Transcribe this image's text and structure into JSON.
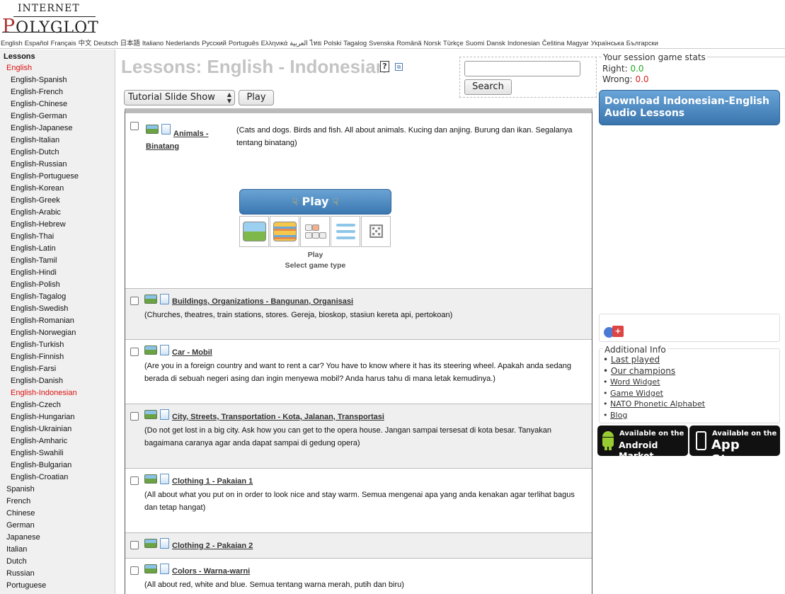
{
  "logo": {
    "top": "INTERNET",
    "first_letter": "P",
    "rest": "OLYGLOT"
  },
  "languages": [
    "English",
    "Español",
    "Français",
    "中文",
    "Deutsch",
    "日本語",
    "Italiano",
    "Nederlands",
    "Русский",
    "Português",
    "Ελληνικά",
    "العربية",
    "ไทย",
    "Polski",
    "Tagalog",
    "Svenska",
    "Română",
    "Norsk",
    "Türkçe",
    "Suomi",
    "Dansk",
    "Indonesian",
    "Čeština",
    "Magyar",
    "Українська",
    "Български"
  ],
  "sidebar": {
    "heading": "Lessons",
    "items": [
      {
        "label": "English",
        "level": 0,
        "active": true
      },
      {
        "label": "English-Spanish",
        "level": 1
      },
      {
        "label": "English-French",
        "level": 1
      },
      {
        "label": "English-Chinese",
        "level": 1
      },
      {
        "label": "English-German",
        "level": 1
      },
      {
        "label": "English-Japanese",
        "level": 1
      },
      {
        "label": "English-Italian",
        "level": 1
      },
      {
        "label": "English-Dutch",
        "level": 1
      },
      {
        "label": "English-Russian",
        "level": 1
      },
      {
        "label": "English-Portuguese",
        "level": 1
      },
      {
        "label": "English-Korean",
        "level": 1
      },
      {
        "label": "English-Greek",
        "level": 1
      },
      {
        "label": "English-Arabic",
        "level": 1
      },
      {
        "label": "English-Hebrew",
        "level": 1
      },
      {
        "label": "English-Thai",
        "level": 1
      },
      {
        "label": "English-Latin",
        "level": 1
      },
      {
        "label": "English-Tamil",
        "level": 1
      },
      {
        "label": "English-Hindi",
        "level": 1
      },
      {
        "label": "English-Polish",
        "level": 1
      },
      {
        "label": "English-Tagalog",
        "level": 1
      },
      {
        "label": "English-Swedish",
        "level": 1
      },
      {
        "label": "English-Romanian",
        "level": 1
      },
      {
        "label": "English-Norwegian",
        "level": 1
      },
      {
        "label": "English-Turkish",
        "level": 1
      },
      {
        "label": "English-Finnish",
        "level": 1
      },
      {
        "label": "English-Farsi",
        "level": 1
      },
      {
        "label": "English-Danish",
        "level": 1
      },
      {
        "label": "English-Indonesian",
        "level": 1,
        "active": true
      },
      {
        "label": "English-Czech",
        "level": 1
      },
      {
        "label": "English-Hungarian",
        "level": 1
      },
      {
        "label": "English-Ukrainian",
        "level": 1
      },
      {
        "label": "English-Amharic",
        "level": 1
      },
      {
        "label": "English-Swahili",
        "level": 1
      },
      {
        "label": "English-Bulgarian",
        "level": 1
      },
      {
        "label": "English-Croatian",
        "level": 1
      },
      {
        "label": "Spanish",
        "level": 0
      },
      {
        "label": "French",
        "level": 0
      },
      {
        "label": "Chinese",
        "level": 0
      },
      {
        "label": "German",
        "level": 0
      },
      {
        "label": "Japanese",
        "level": 0
      },
      {
        "label": "Italian",
        "level": 0
      },
      {
        "label": "Dutch",
        "level": 0
      },
      {
        "label": "Russian",
        "level": 0
      },
      {
        "label": "Portuguese",
        "level": 0
      }
    ]
  },
  "main": {
    "title": "Lessons: English - Indonesian",
    "help_glyph": "?",
    "ext_glyph": "⧉",
    "mode_select": "Tutorial Slide Show",
    "play_label": "Play",
    "play_big_label": "Play",
    "game_caption_1": "Play",
    "game_caption_2": "Select game type",
    "lessons": [
      {
        "title": "Animals - Binatang",
        "desc": "(Cats and dogs. Birds and fish. All about animals. Kucing dan anjing. Burung dan ikan. Segalanya tentang binatang)"
      },
      {
        "title": "Buildings, Organizations - Bangunan, Organisasi",
        "desc": "(Churches, theatres, train stations, stores. Gereja, bioskop, stasiun kereta api, pertokoan)"
      },
      {
        "title": "Car - Mobil",
        "desc": "(Are you in a foreign country and want to rent a car? You have to know where it has its steering wheel. Apakah anda sedang berada di sebuah negeri asing dan ingin menyewa mobil? Anda harus tahu di mana letak kemudinya.)"
      },
      {
        "title": "City, Streets, Transportation - Kota, Jalanan, Transportasi",
        "desc": "(Do not get lost in a big city. Ask how you can get to the opera house. Jangan sampai tersesat di kota besar. Tanyakan bagaimana caranya agar anda dapat sampai di gedung opera)"
      },
      {
        "title": "Clothing 1 - Pakaian 1",
        "desc": "(All about what you put on in order to look nice and stay warm. Semua mengenai apa yang anda kenakan agar terlihat bagus dan tetap hangat)"
      },
      {
        "title": "Clothing 2 - Pakaian 2",
        "desc": ""
      },
      {
        "title": "Colors - Warna-warni",
        "desc": "(All about red, white and blue. Semua tentang warna merah, putih dan biru)"
      }
    ]
  },
  "search": {
    "button": "Search",
    "value": ""
  },
  "stats": {
    "legend": "Your session game stats",
    "right_label": "Right:",
    "right_value": "0.0",
    "wrong_label": "Wrong:",
    "wrong_value": "0.0"
  },
  "download": {
    "line1": "Download Indonesian-English",
    "line2": "Audio Lessons"
  },
  "additional": {
    "legend": "Additional Info",
    "links": [
      "Last played",
      "Our champions",
      "Word Widget",
      "Game Widget",
      "NATO Phonetic Alphabet",
      "Blog"
    ]
  },
  "stores": {
    "android_small": "Available on the",
    "android_big": "Android Market",
    "apple_small": "Available on the",
    "apple_big": "App Store"
  },
  "colors": {
    "accent_red": "#dd1111",
    "button_blue": "#3b78b2",
    "right_green": "#22aa22",
    "wrong_red": "#dd2222"
  }
}
